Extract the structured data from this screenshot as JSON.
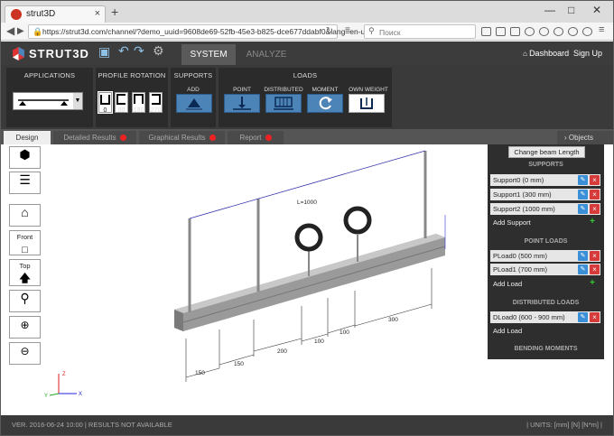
{
  "browser": {
    "tab_title": "strut3D",
    "tab_close": "×",
    "new_tab": "+",
    "url": "https://strut3d.com/channel/?demo_uuid=9608de69-52fb-45e3-b825-dce677ddabf0&lang=en-us#",
    "search_placeholder": "Поиск",
    "win_min": "—",
    "win_max": "□",
    "win_close": "✕"
  },
  "app": {
    "brand": "STRUT3D",
    "tabs": [
      "SYSTEM",
      "ANALYZE"
    ],
    "dashboard": "Dashboard",
    "signup": "Sign Up"
  },
  "ribbon": {
    "applications": "APPLICATIONS",
    "profile_rotation": "PROFILE ROTATION",
    "profile_angles": [
      "0",
      "90",
      "180",
      "270"
    ],
    "supports": "SUPPORTS",
    "supports_add": "ADD",
    "loads": "LOADS",
    "load_buttons": [
      "POINT",
      "DISTRIBUTED",
      "MOMENT",
      "OWN WEIGHT"
    ]
  },
  "workspace_tabs": [
    "Design",
    "Detailed Results",
    "Graphical Results",
    "Report"
  ],
  "objects_button": "Objects",
  "tools": {
    "front": "Front",
    "top": "Top"
  },
  "panel": {
    "change_beam": "Change beam Length",
    "supports_title": "SUPPORTS",
    "supports": [
      "Support0 (0 mm)",
      "Support1 (300 mm)",
      "Support2 (1000 mm)"
    ],
    "add_support": "Add Support",
    "point_loads_title": "POINT LOADS",
    "point_loads": [
      "PLoad0 (500 mm)",
      "PLoad1 (700 mm)"
    ],
    "add_load": "Add Load",
    "dist_loads_title": "DISTRIBUTED LOADS",
    "dist_loads": [
      "DLoad0 (600 - 900 mm)"
    ],
    "add_dist_load": "Add Load",
    "bending_title": "BENDING MOMENTS"
  },
  "scene": {
    "length_label": "L=1000",
    "dimensions": [
      "150",
      "150",
      "200",
      "100",
      "100",
      "300"
    ],
    "axes": [
      "X",
      "Y",
      "Z"
    ]
  },
  "status": {
    "version": "VER. 2016-06-24 10:00 | RESULTS NOT AVAILABLE",
    "units": "| UNITS: [mm] [N] [N*m] |"
  },
  "colors": {
    "accent": "#4d84b7",
    "error_dot": "#e22222",
    "edit_btn": "#3a8fd6",
    "delete_btn": "#d63a3a",
    "add_plus": "#33cc33"
  }
}
